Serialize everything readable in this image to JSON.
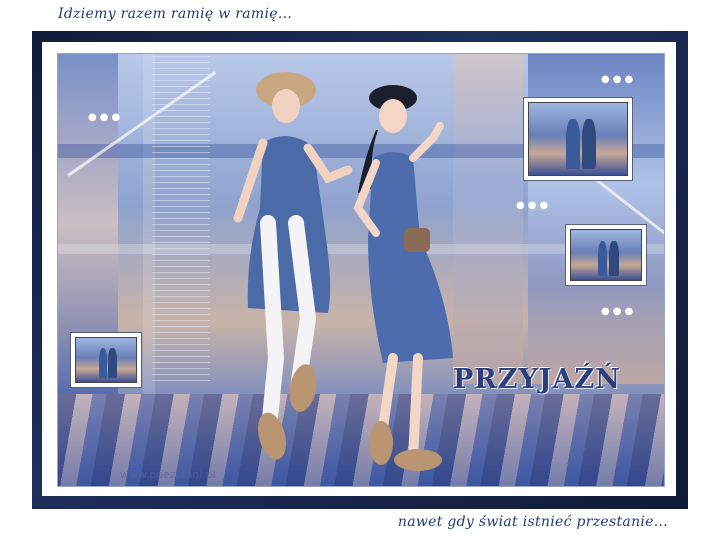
{
  "captions": {
    "top": "Idziemy razem ramię w ramię...",
    "bottom": "nawet gdy świat istnieć przestanie..."
  },
  "artwork": {
    "title_logo": "PRZYJAŹŃ",
    "watermark": "www.poezjaani.pl",
    "thumbnail_count": 3
  },
  "colors": {
    "frame": "#1e2f5c",
    "caption_text": "#1f3a7a",
    "logo_text": "#2d3f7a"
  }
}
